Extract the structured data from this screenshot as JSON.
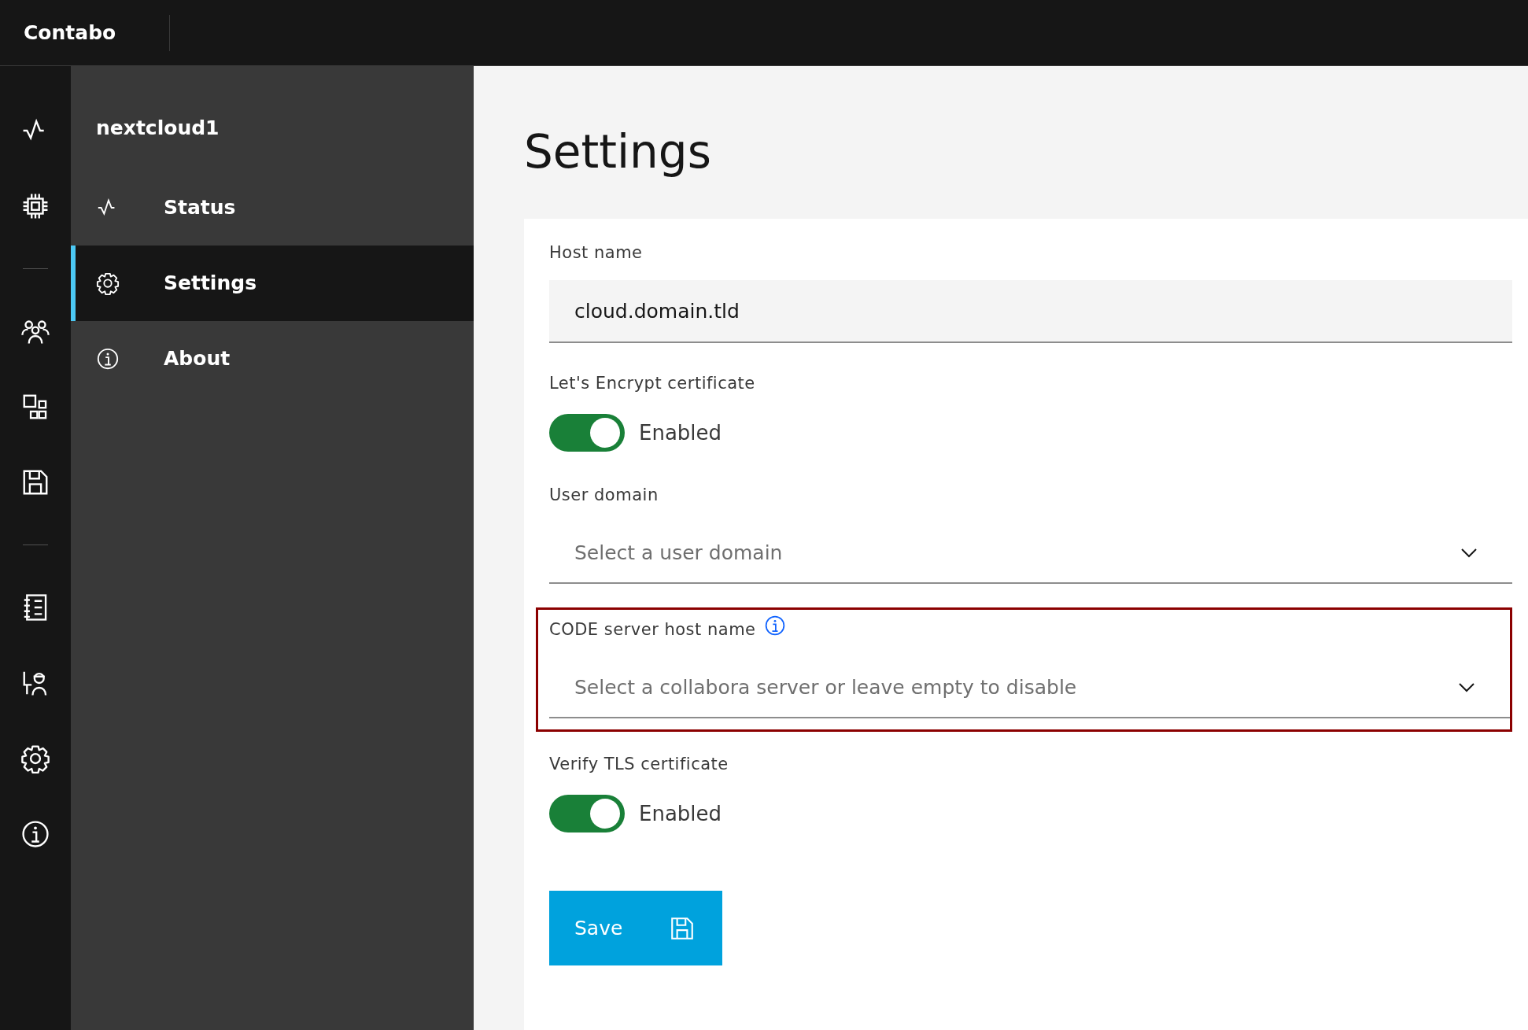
{
  "header": {
    "brand": "Contabo"
  },
  "rail": [
    {
      "kind": "pulse"
    },
    {
      "kind": "chip"
    },
    {
      "kind": "divider"
    },
    {
      "kind": "people"
    },
    {
      "kind": "apps"
    },
    {
      "kind": "save"
    },
    {
      "kind": "divider"
    },
    {
      "kind": "notebook"
    },
    {
      "kind": "admin"
    },
    {
      "kind": "gear"
    },
    {
      "kind": "info"
    }
  ],
  "sidebar": {
    "title": "nextcloud1",
    "items": [
      {
        "label": "Status",
        "selected": false
      },
      {
        "label": "Settings",
        "selected": true
      },
      {
        "label": "About",
        "selected": false
      }
    ]
  },
  "page": {
    "title": "Settings"
  },
  "fields": [
    {
      "kind": "text",
      "label": "Host name",
      "value": "cloud.domain.tld",
      "highlighted": false
    },
    {
      "kind": "toggle",
      "label": "Let's Encrypt certificate",
      "on": true,
      "state_text": "Enabled",
      "highlighted": false
    },
    {
      "kind": "select",
      "label": "User domain",
      "placeholder": "Select a user domain",
      "highlighted": false
    },
    {
      "kind": "select",
      "label": "CODE server host name",
      "info": true,
      "placeholder": "Select a collabora server or leave empty to disable",
      "highlighted": true
    },
    {
      "kind": "toggle",
      "label": "Verify TLS certificate",
      "on": true,
      "state_text": "Enabled",
      "highlighted": false
    }
  ],
  "save_button": {
    "label": "Save"
  }
}
